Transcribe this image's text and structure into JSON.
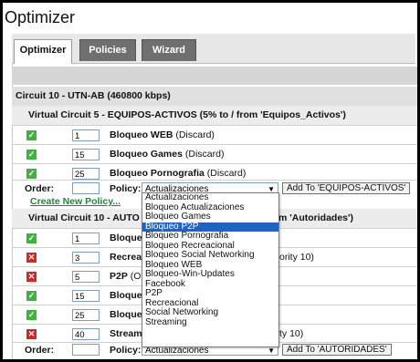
{
  "app": {
    "title": "Optimizer"
  },
  "tabs": [
    {
      "label": "Optimizer"
    },
    {
      "label": "Policies"
    },
    {
      "label": "Wizard"
    }
  ],
  "circuit": {
    "header": "Circuit 10 - UTN-AB (460800 kbps)"
  },
  "vc5": {
    "header": "Virtual Circuit 5 - EQUIPOS-ACTIVOS (5% to / from 'Equipos_Activos')",
    "rules": [
      {
        "status": "enabled",
        "order": "1",
        "name": "Bloqueo WEB",
        "action": "(Discard)"
      },
      {
        "status": "enabled",
        "order": "15",
        "name": "Bloqueo Games",
        "action": "(Discard)"
      },
      {
        "status": "enabled",
        "order": "25",
        "name": "Bloqueo Pornografia",
        "action": "(Discard)"
      }
    ],
    "order_label": "Order:",
    "order_value": "",
    "policy_label": "Policy:",
    "policy_selected": "Actualizaciones",
    "add_button": "Add To 'EQUIPOS-ACTIVOS'",
    "create_link": "Create New Policy..."
  },
  "vc10": {
    "header_left": "Virtual Circuit 10 - AUTO",
    "header_right": "m 'Autoridades')",
    "rules": [
      {
        "status": "enabled",
        "order": "1",
        "name": "Bloqueo",
        "trail": ""
      },
      {
        "status": "disabled",
        "order": "3",
        "name": "Recreac",
        "trail": "ority 10)"
      },
      {
        "status": "disabled",
        "order": "5",
        "name": "P2P",
        "action": "(Op",
        "trail": ""
      },
      {
        "status": "enabled",
        "order": "15",
        "name": "Bloqueo",
        "trail": ""
      },
      {
        "status": "enabled",
        "order": "25",
        "name": "Bloqueo",
        "trail": ""
      },
      {
        "status": "disabled",
        "order": "40",
        "name": "Streami",
        "trail": "ty 10)"
      }
    ],
    "order_label": "Order:",
    "order_value": "",
    "policy_label": "Policy:",
    "policy_selected": "Actualizaciones",
    "add_button": "Add To 'AUTORIDADES'"
  },
  "dropdown": {
    "options": [
      "Actualizaciones",
      "Bloqueo Actualizaciones",
      "Bloqueo Games",
      "Bloqueo P2P",
      "Bloqueo Pornografia",
      "Bloqueo Recreacional",
      "Bloqueo Social Networking",
      "Bloqueo WEB",
      "Bloqueo-Win-Updates",
      "Facebook",
      "P2P",
      "Recreacional",
      "Social Networking",
      "Streaming"
    ],
    "highlighted": "Bloqueo P2P"
  },
  "icons": {
    "enabled": "check-icon",
    "disabled": "x-icon"
  },
  "colors": {
    "enabled": "#3db53d",
    "disabled": "#d6261f",
    "link": "#1a8a3a",
    "highlight": "#1e64c8"
  }
}
